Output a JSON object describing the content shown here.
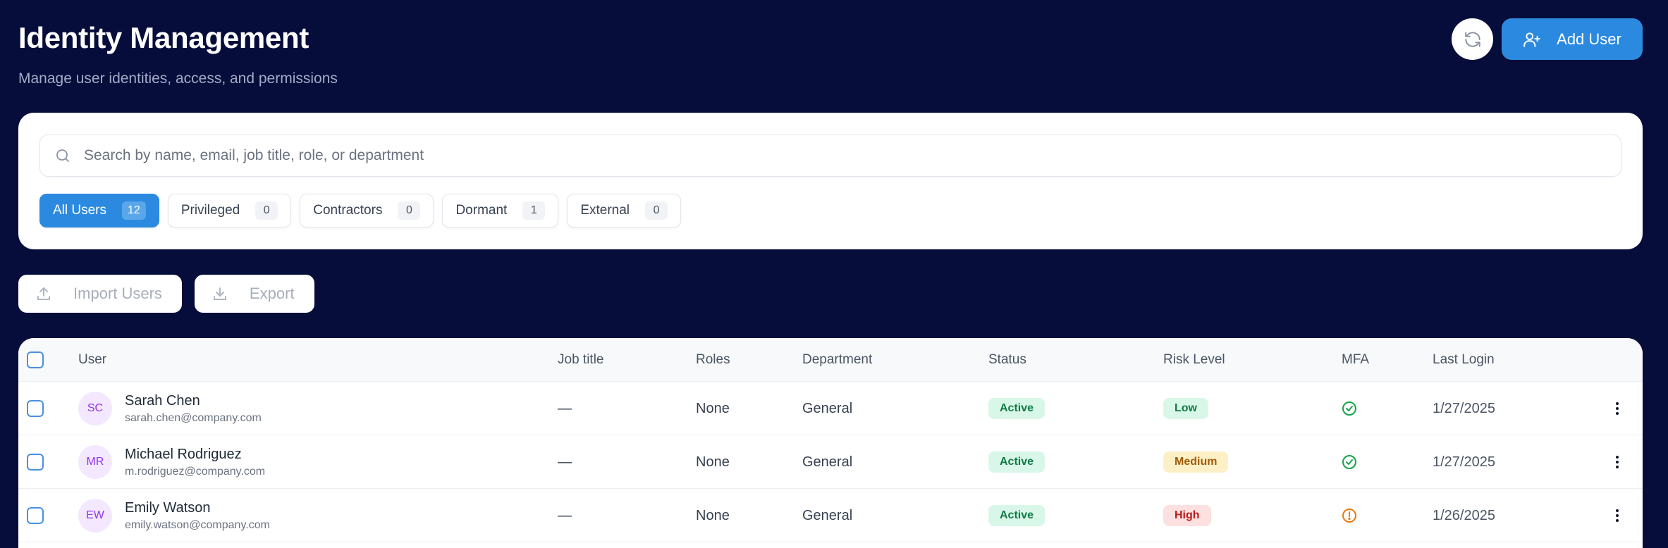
{
  "header": {
    "title": "Identity Management",
    "subtitle": "Manage user identities, access, and permissions",
    "add_user_label": "Add User"
  },
  "search": {
    "placeholder": "Search by name, email, job title, role, or department",
    "value": ""
  },
  "filters": [
    {
      "label": "All Users",
      "count": "12",
      "active": true
    },
    {
      "label": "Privileged",
      "count": "0",
      "active": false
    },
    {
      "label": "Contractors",
      "count": "0",
      "active": false
    },
    {
      "label": "Dormant",
      "count": "1",
      "active": false
    },
    {
      "label": "External",
      "count": "0",
      "active": false
    }
  ],
  "actions": {
    "import_label": "Import Users",
    "export_label": "Export"
  },
  "table": {
    "columns": [
      "User",
      "Job title",
      "Roles",
      "Department",
      "Status",
      "Risk Level",
      "MFA",
      "Last Login"
    ],
    "rows": [
      {
        "initials": "SC",
        "name": "Sarah Chen",
        "email": "sarah.chen@company.com",
        "job_title": "—",
        "roles": "None",
        "department": "General",
        "status": "Active",
        "risk": "Low",
        "mfa": "verified",
        "last_login": "1/27/2025"
      },
      {
        "initials": "MR",
        "name": "Michael Rodriguez",
        "email": "m.rodriguez@company.com",
        "job_title": "—",
        "roles": "None",
        "department": "General",
        "status": "Active",
        "risk": "Medium",
        "mfa": "verified",
        "last_login": "1/27/2025"
      },
      {
        "initials": "EW",
        "name": "Emily Watson",
        "email": "emily.watson@company.com",
        "job_title": "—",
        "roles": "None",
        "department": "General",
        "status": "Active",
        "risk": "High",
        "mfa": "warning",
        "last_login": "1/26/2025"
      }
    ]
  },
  "colors": {
    "background": "#070d3b",
    "accent": "#2b8ae0",
    "mfa_ok": "#16a34a",
    "mfa_warn": "#ea7a0c"
  },
  "icons": {
    "refresh": "refresh-icon",
    "add_user": "user-plus-icon",
    "search": "search-icon",
    "import": "upload-icon",
    "export": "download-icon",
    "mfa_ok": "check-circle-icon",
    "mfa_warn": "alert-circle-icon",
    "row_menu": "more-vertical-icon"
  }
}
